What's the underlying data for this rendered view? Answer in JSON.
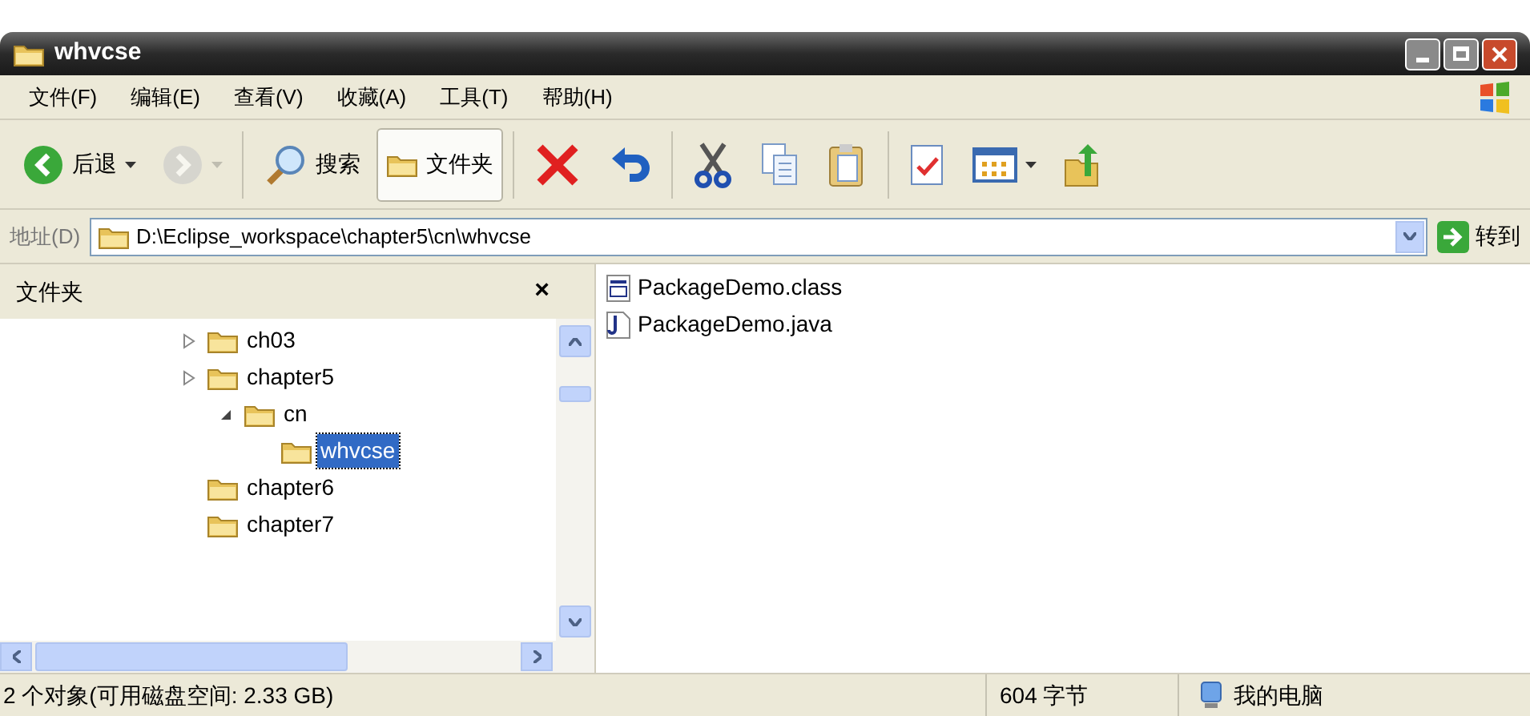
{
  "window": {
    "title": "whvcse"
  },
  "menu": [
    {
      "label": "文件(F)"
    },
    {
      "label": "编辑(E)"
    },
    {
      "label": "查看(V)"
    },
    {
      "label": "收藏(A)"
    },
    {
      "label": "工具(T)"
    },
    {
      "label": "帮助(H)"
    }
  ],
  "toolbar": [
    {
      "kind": "back",
      "label": "后退",
      "disabled": false,
      "dropdown": true
    },
    {
      "kind": "forward",
      "disabled": true,
      "dropdown": true
    },
    {
      "kind": "sep"
    },
    {
      "kind": "search",
      "label": "搜索",
      "selected": false
    },
    {
      "kind": "folders",
      "label": "文件夹",
      "selected": true
    },
    {
      "kind": "sep"
    },
    {
      "kind": "delete"
    },
    {
      "kind": "undo"
    },
    {
      "kind": "sep"
    },
    {
      "kind": "cut"
    },
    {
      "kind": "copy"
    },
    {
      "kind": "paste"
    },
    {
      "kind": "sep"
    },
    {
      "kind": "properties"
    },
    {
      "kind": "views",
      "dropdown": true
    },
    {
      "kind": "up"
    }
  ],
  "address": {
    "label": "地址(D)",
    "value": "D:\\Eclipse_workspace\\chapter5\\cn\\whvcse",
    "go": "转到"
  },
  "folders_panel": {
    "title": "文件夹",
    "close": "×",
    "tree": [
      {
        "label": "ch03",
        "has_expander": true,
        "expanded": false,
        "selected": false
      },
      {
        "label": "chapter5",
        "has_expander": true,
        "expanded": false,
        "selected": false,
        "children": [
          {
            "label": "cn",
            "has_expander": true,
            "expanded": true,
            "selected": false,
            "children": [
              {
                "label": "whvcse",
                "has_expander": false,
                "selected": true
              }
            ]
          }
        ]
      },
      {
        "label": "chapter6",
        "has_expander": false,
        "selected": false
      },
      {
        "label": "chapter7",
        "has_expander": false,
        "selected": false
      }
    ]
  },
  "files": [
    {
      "name": "PackageDemo.class",
      "kind": "class"
    },
    {
      "name": "PackageDemo.java",
      "kind": "java"
    }
  ],
  "status_bar": {
    "objects": "2 个对象(可用磁盘空间: 2.33 GB)",
    "size": "604 字节",
    "zone": "我的电脑"
  }
}
